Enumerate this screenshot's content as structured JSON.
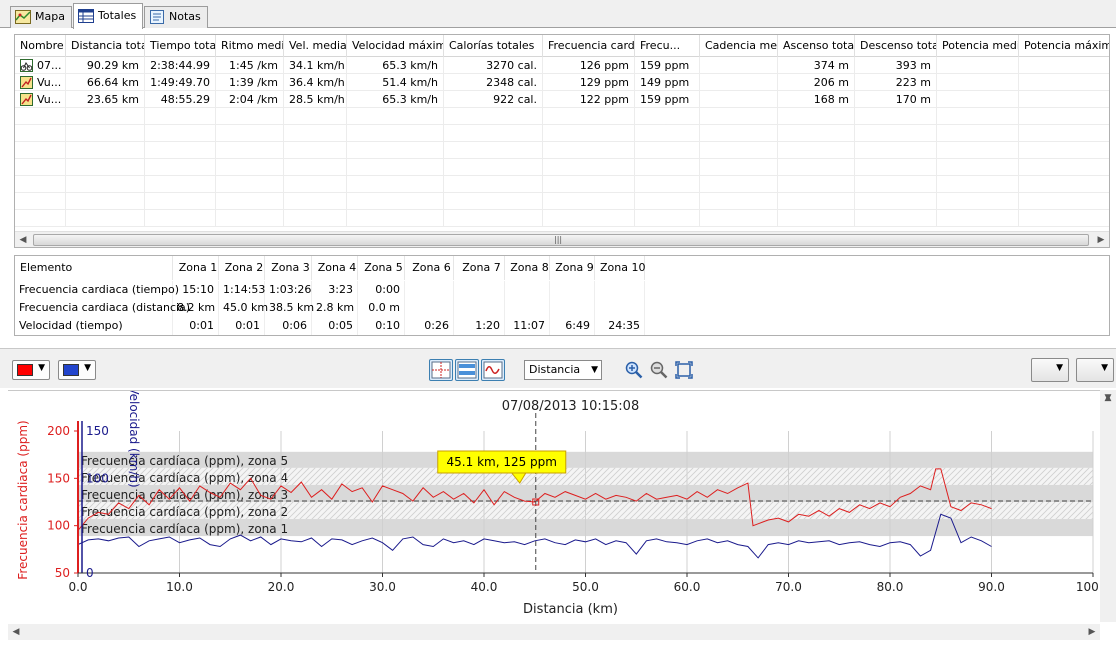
{
  "tabs": [
    {
      "label": "Mapa",
      "icon": "map-icon",
      "active": false
    },
    {
      "label": "Totales",
      "icon": "table-icon",
      "active": true
    },
    {
      "label": "Notas",
      "icon": "notes-icon",
      "active": false
    }
  ],
  "totals": {
    "columns": [
      "Nombre",
      "Distancia total",
      "Tiempo total",
      "Ritmo medio",
      "Vel. media",
      "Velocidad máxima",
      "Calorías totales",
      "Frecuencia cardi...",
      "Frecu...",
      "Cadencia media",
      "Ascenso total",
      "Descenso total",
      "Potencia media",
      "Potencia máxima"
    ],
    "rows": [
      {
        "icon": "bike-activity-icon",
        "cells": [
          "07...",
          "90.29 km",
          "2:38:44.99",
          "1:45 /km",
          "34.1 km/h",
          "65.3 km/h",
          "3270 cal.",
          "126 ppm",
          "159 ppm",
          "",
          "374 m",
          "393 m",
          "",
          ""
        ]
      },
      {
        "icon": "route-lap-icon",
        "cells": [
          "Vu...",
          "66.64 km",
          "1:49:49.70",
          "1:39 /km",
          "36.4 km/h",
          "51.4 km/h",
          "2348 cal.",
          "129 ppm",
          "149 ppm",
          "",
          "206 m",
          "223 m",
          "",
          ""
        ]
      },
      {
        "icon": "route-lap-icon",
        "cells": [
          "Vu...",
          "23.65 km",
          "48:55.29",
          "2:04 /km",
          "28.5 km/h",
          "65.3 km/h",
          "922 cal.",
          "122 ppm",
          "159 ppm",
          "",
          "168 m",
          "170 m",
          "",
          ""
        ]
      }
    ]
  },
  "zones": {
    "columns": [
      "Elemento",
      "Zona 1",
      "Zona 2",
      "Zona 3",
      "Zona 4",
      "Zona 5",
      "Zona 6",
      "Zona 7",
      "Zona 8",
      "Zona 9",
      "Zona 10"
    ],
    "rows": [
      [
        "Frecuencia cardiaca (tiempo)",
        "15:10",
        "1:14:53",
        "1:03:26",
        "3:23",
        "0:00",
        "",
        "",
        "",
        "",
        ""
      ],
      [
        "Frecuencia cardiaca (distancia)",
        "8.2 km",
        "45.0 km",
        "38.5 km",
        "2.8 km",
        "0.0 m",
        "",
        "",
        "",
        "",
        ""
      ],
      [
        "Velocidad (tiempo)",
        "0:01",
        "0:01",
        "0:06",
        "0:05",
        "0:10",
        "0:26",
        "1:20",
        "11:07",
        "6:49",
        "24:35"
      ]
    ]
  },
  "toolbar": {
    "color1": "#ff0000",
    "color2": "#2244cc",
    "xaxis_select": "Distancia"
  },
  "chart_data": {
    "type": "line",
    "title": "07/08/2013 10:15:08",
    "xlabel": "Distancia (km)",
    "ylabel": "Frecuencia cardiaca (ppm)",
    "y2label": "Velocidad (km/h)",
    "xlim": [
      0,
      100
    ],
    "xticks": [
      "0.0",
      "10.0",
      "20.0",
      "30.0",
      "40.0",
      "50.0",
      "60.0",
      "70.0",
      "80.0",
      "90.0",
      "100.0"
    ],
    "ylim": [
      50,
      200
    ],
    "yticks": [
      "50",
      "100",
      "150",
      "200"
    ],
    "y2lim": [
      0,
      150
    ],
    "y2ticks": [
      "0",
      "100",
      "150"
    ],
    "grid": true,
    "zones": [
      {
        "label": "Frecuencia cardíaca (ppm), zona 5",
        "from": 161,
        "to": 178,
        "pattern": "solid"
      },
      {
        "label": "Frecuencia cardíaca (ppm), zona 4",
        "from": 143,
        "to": 161,
        "pattern": "hatch"
      },
      {
        "label": "Frecuencia cardíaca (ppm), zona 3",
        "from": 125,
        "to": 143,
        "pattern": "solid"
      },
      {
        "label": "Frecuencia cardíaca (ppm), zona 2",
        "from": 107,
        "to": 125,
        "pattern": "hatch"
      },
      {
        "label": "Frecuencia cardíaca (ppm), zona 1",
        "from": 89,
        "to": 107,
        "pattern": "solid"
      }
    ],
    "average_line": 126,
    "cursor": {
      "x": 45.1,
      "y": 125,
      "label": "45.1 km, 125 ppm"
    },
    "series": [
      {
        "name": "Frecuencia cardiaca",
        "axis": "left",
        "color": "#dd1f1f",
        "x": [
          0,
          1,
          2,
          3,
          4,
          5,
          6,
          7,
          8,
          9,
          10,
          11,
          12,
          13,
          14,
          15,
          16,
          17,
          18,
          19,
          20,
          21,
          22,
          23,
          24,
          25,
          26,
          27,
          28,
          29,
          30,
          31,
          32,
          33,
          34,
          35,
          36,
          37,
          38,
          39,
          40,
          41,
          42,
          43,
          44,
          45,
          46,
          47,
          48,
          49,
          50,
          51,
          52,
          53,
          54,
          55,
          56,
          57,
          58,
          59,
          60,
          61,
          62,
          63,
          64,
          65,
          66,
          66.5,
          67,
          68,
          69,
          70,
          71,
          72,
          73,
          74,
          75,
          76,
          77,
          78,
          79,
          80,
          81,
          82,
          83,
          84,
          84.5,
          85,
          86,
          87,
          88,
          89,
          90
        ],
        "y": [
          95,
          108,
          114,
          112,
          124,
          118,
          132,
          122,
          138,
          128,
          140,
          126,
          142,
          135,
          130,
          145,
          138,
          150,
          132,
          128,
          142,
          135,
          146,
          130,
          138,
          128,
          144,
          136,
          140,
          125,
          142,
          138,
          134,
          126,
          140,
          130,
          136,
          128,
          134,
          124,
          138,
          122,
          136,
          130,
          126,
          125,
          134,
          130,
          136,
          132,
          128,
          134,
          128,
          132,
          130,
          126,
          134,
          128,
          130,
          132,
          128,
          136,
          130,
          138,
          134,
          140,
          145,
          100,
          102,
          106,
          108,
          104,
          112,
          110,
          116,
          110,
          118,
          114,
          122,
          118,
          124,
          120,
          130,
          134,
          142,
          138,
          160,
          160,
          120,
          116,
          124,
          122,
          118
        ]
      },
      {
        "name": "Velocidad",
        "axis": "right",
        "color": "#1a1a8c",
        "x": [
          0,
          1,
          2,
          3,
          4,
          5,
          6,
          7,
          8,
          9,
          10,
          11,
          12,
          13,
          14,
          15,
          16,
          17,
          18,
          19,
          20,
          21,
          22,
          23,
          24,
          25,
          26,
          27,
          28,
          29,
          30,
          31,
          32,
          33,
          34,
          35,
          36,
          37,
          38,
          39,
          40,
          41,
          42,
          43,
          44,
          45,
          46,
          47,
          48,
          49,
          50,
          51,
          52,
          53,
          54,
          55,
          56,
          57,
          58,
          59,
          60,
          61,
          62,
          63,
          64,
          65,
          66,
          67,
          68,
          69,
          70,
          71,
          72,
          73,
          74,
          75,
          76,
          77,
          78,
          79,
          80,
          81,
          82,
          83,
          84,
          85,
          86,
          87,
          88,
          89,
          90
        ],
        "y": [
          30,
          35,
          36,
          34,
          37,
          38,
          28,
          34,
          36,
          38,
          32,
          35,
          37,
          30,
          28,
          36,
          40,
          34,
          38,
          30,
          36,
          34,
          33,
          37,
          28,
          36,
          35,
          30,
          34,
          37,
          32,
          24,
          36,
          38,
          30,
          28,
          36,
          32,
          34,
          30,
          36,
          34,
          32,
          33,
          30,
          34,
          36,
          32,
          30,
          35,
          33,
          36,
          30,
          34,
          32,
          20,
          34,
          36,
          33,
          32,
          30,
          34,
          36,
          32,
          34,
          30,
          28,
          16,
          30,
          32,
          30,
          34,
          32,
          33,
          34,
          30,
          32,
          33,
          30,
          28,
          32,
          33,
          30,
          18,
          24,
          62,
          58,
          32,
          38,
          34,
          28
        ]
      }
    ]
  }
}
